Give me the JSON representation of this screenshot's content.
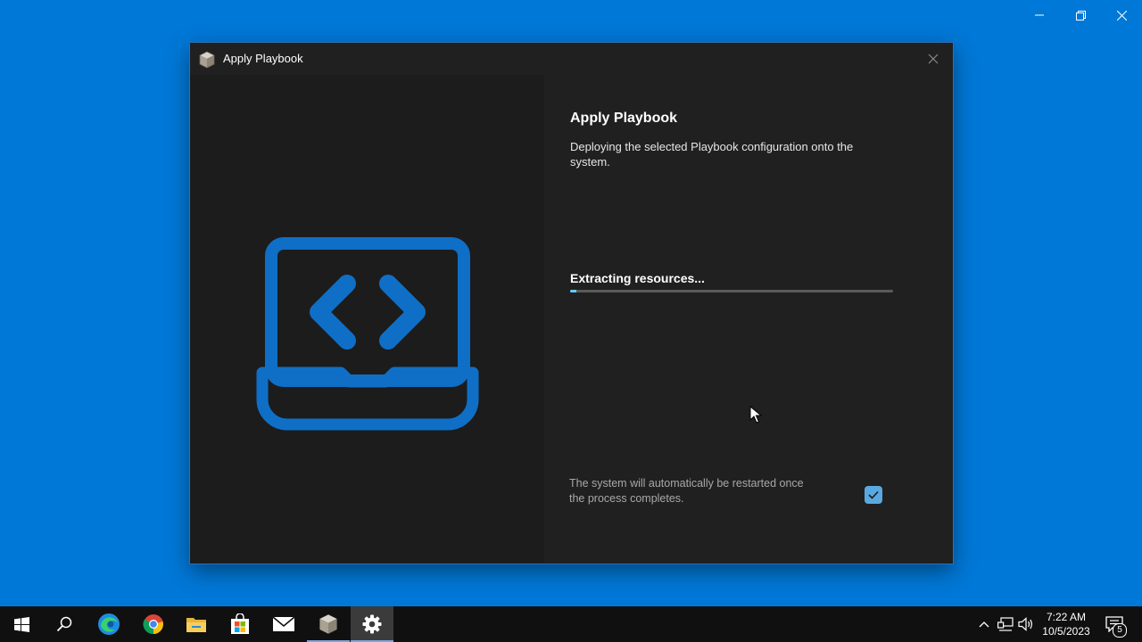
{
  "dialog": {
    "title": "Apply Playbook",
    "heading": "Apply Playbook",
    "description": "Deploying the selected Playbook configuration onto the system.",
    "status": "Extracting resources...",
    "progress": 0.02,
    "restart_note": "The system will automatically be restarted once the process completes.",
    "restart_checked": true
  },
  "taskbar": {
    "apps": [
      "start-icon",
      "search-icon",
      "edge-icon",
      "chrome-icon",
      "file-explorer-icon",
      "store-icon",
      "mail-icon",
      "playbook-app-icon",
      "settings-icon"
    ],
    "clock_time": "7:22 AM",
    "clock_date": "10/5/2023",
    "notification_count": "5"
  },
  "colors": {
    "desktop": "#0078d7",
    "accent": "#60cdff",
    "illustration": "#0f6fc6"
  }
}
